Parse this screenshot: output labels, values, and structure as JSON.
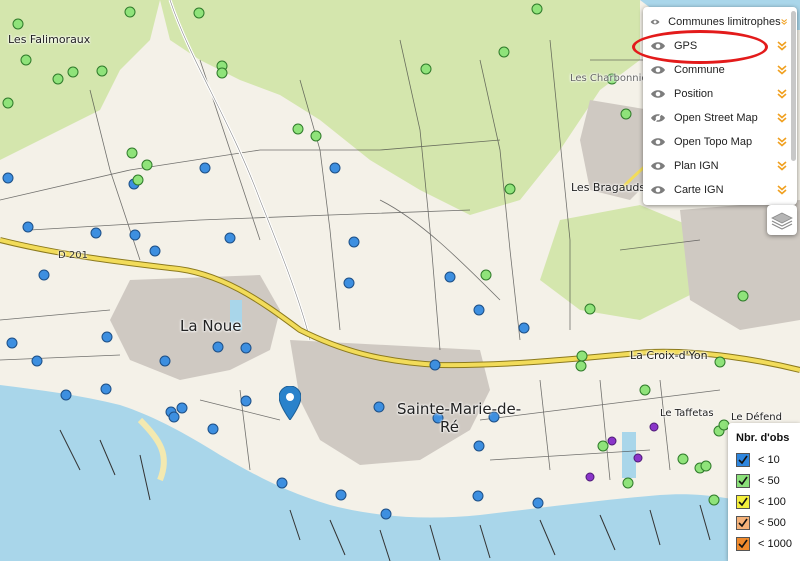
{
  "places": {
    "les_falimoraux": "Les Falimoraux",
    "les_charbonnieres": "Les Charbonnières",
    "la_noue": "La Noue",
    "sainte_marie_line1": "Sainte-Marie-de-",
    "sainte_marie_line2": "Ré",
    "les_bragauds": "Les Bragauds",
    "la_croix_d_yon": "La Croix-d'Yon",
    "le_taffetas": "Le Taffetas",
    "le_defend": "Le Défend",
    "road_d201": "D 201"
  },
  "layer_panel": {
    "layers": [
      {
        "name": "Communes limitrophes",
        "visible": true
      },
      {
        "name": "GPS",
        "visible": true
      },
      {
        "name": "Commune",
        "visible": true
      },
      {
        "name": "Position",
        "visible": true
      },
      {
        "name": "Open Street Map",
        "visible": false
      },
      {
        "name": "Open Topo Map",
        "visible": true
      },
      {
        "name": "Plan IGN",
        "visible": true
      },
      {
        "name": "Carte IGN",
        "visible": true
      }
    ]
  },
  "legend": {
    "title": "Nbr. d'obs",
    "items": [
      {
        "label": "< 10",
        "color": "#2e86de"
      },
      {
        "label": "< 50",
        "color": "#8be07a"
      },
      {
        "label": "< 100",
        "color": "#f4ef3c"
      },
      {
        "label": "< 500",
        "color": "#f5b27a"
      },
      {
        "label": "< 1000",
        "color": "#f08a2c"
      }
    ]
  },
  "colors": {
    "sea": "#a9d6ea",
    "land": "#f4f1e8",
    "vegetation": "#d4e6ad",
    "town": "#c9c4bd",
    "main_road": "#f2dc5a",
    "highlight": "#e31b1b",
    "obs_blue": "#3d8fe0",
    "obs_green": "#8fe37a",
    "obs_purple": "#8a35c9"
  }
}
